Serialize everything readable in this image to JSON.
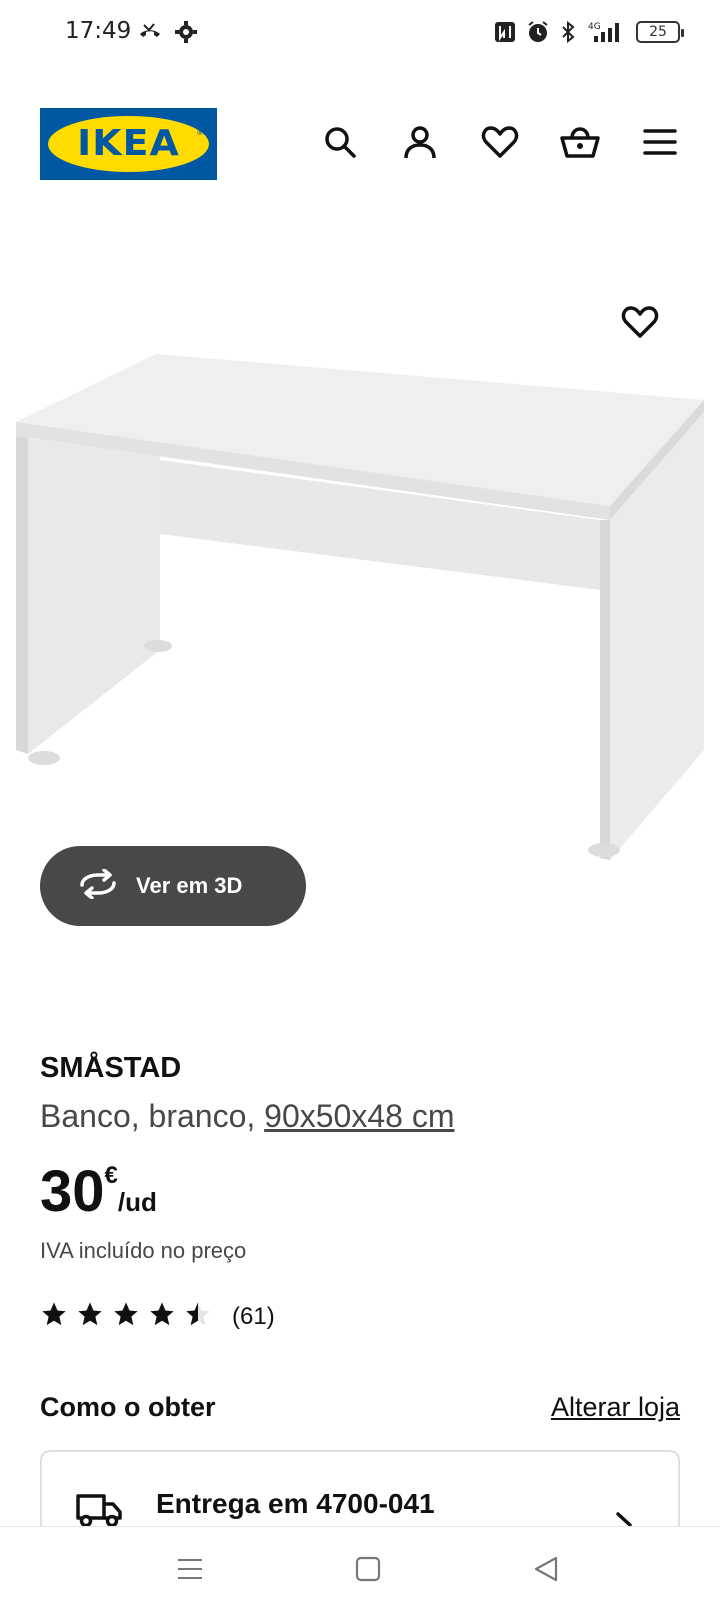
{
  "status_bar": {
    "time": "17:49",
    "battery": "25",
    "icons": [
      "missed-call-icon",
      "settings-icon",
      "nfc-icon",
      "alarm-icon",
      "bluetooth-icon",
      "signal-4g-icon",
      "battery-icon"
    ]
  },
  "header": {
    "logo_text": "IKEA",
    "logo_reg": "®",
    "icons": [
      "search-icon",
      "user-icon",
      "heart-icon",
      "basket-icon",
      "menu-icon"
    ]
  },
  "product": {
    "view3d_label": "Ver em 3D",
    "name": "SMÅSTAD",
    "desc_prefix": "Banco, branco, ",
    "dimensions": "90x50x48 cm",
    "price_int": "30",
    "currency": "€",
    "unit": "/ud",
    "vat_note": "IVA incluído no preço",
    "rating": 4.5,
    "rating_count": "(61)"
  },
  "availability": {
    "title": "Como o obter",
    "change_store": "Alterar loja",
    "delivery_label": "Entrega em 4700-041"
  },
  "colors": {
    "ikea_blue": "#0058a3",
    "ikea_yellow": "#ffdb00",
    "button_dark": "#484848"
  }
}
